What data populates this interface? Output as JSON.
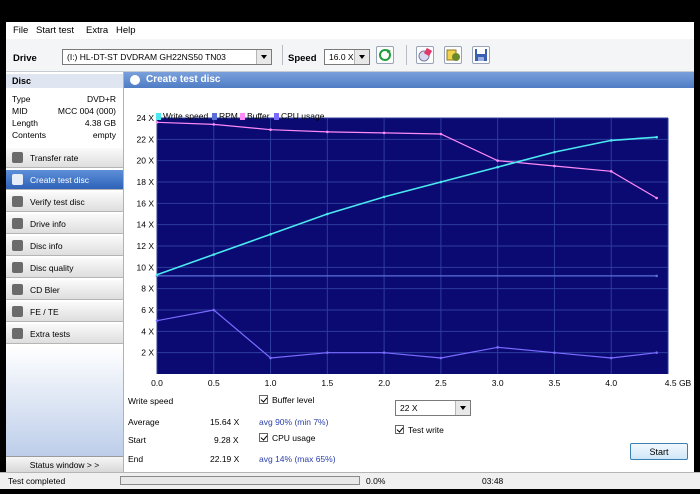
{
  "menu": [
    "File",
    "Start test",
    "Extra",
    "Help"
  ],
  "toolbar": {
    "drive_label": "Drive",
    "drive_value": "(I:)   HL-DT-ST DVDRAM GH22NS50 TN03",
    "speed_label": "Speed",
    "speed_value": "16.0 X",
    "icons": [
      "refresh-icon",
      "erase-disc-icon",
      "media-info-icon",
      "save-icon"
    ]
  },
  "disc": {
    "header": "Disc",
    "rows": [
      {
        "k": "Type",
        "v": "DVD+R"
      },
      {
        "k": "MID",
        "v": "MCC 004 (000)"
      },
      {
        "k": "Length",
        "v": "4.38 GB"
      },
      {
        "k": "Contents",
        "v": "empty"
      }
    ]
  },
  "nav": [
    {
      "label": "Transfer rate",
      "active": false
    },
    {
      "label": "Create test disc",
      "active": true
    },
    {
      "label": "Verify test disc",
      "active": false
    },
    {
      "label": "Drive info",
      "active": false
    },
    {
      "label": "Disc info",
      "active": false
    },
    {
      "label": "Disc quality",
      "active": false
    },
    {
      "label": "CD Bler",
      "active": false
    },
    {
      "label": "FE / TE",
      "active": false
    },
    {
      "label": "Extra tests",
      "active": false
    }
  ],
  "status_window_label": "Status window > >",
  "main_title": "Create test disc",
  "colors": {
    "write": "#4ce8f0",
    "rpm": "#5a6fd8",
    "buffer": "#ff8af8",
    "cpu": "#7a6aff",
    "plot_bg": "#0a0a72",
    "grid": "#2d3d9e"
  },
  "chart_data": {
    "type": "line",
    "xlabel": "",
    "ylabel": "",
    "x_unit": "GB",
    "y_unit": "X",
    "xlim": [
      0,
      4.5
    ],
    "ylim": [
      0,
      24
    ],
    "x_ticks": [
      "0.0",
      "0.5",
      "1.0",
      "1.5",
      "2.0",
      "2.5",
      "3.0",
      "3.5",
      "4.0",
      "4.5 GB"
    ],
    "y_ticks": [
      "2 X",
      "4 X",
      "6 X",
      "8 X",
      "10 X",
      "12 X",
      "14 X",
      "16 X",
      "18 X",
      "20 X",
      "22 X",
      "24 X"
    ],
    "grid": true,
    "legend_position": "top-left",
    "series": [
      {
        "name": "Write speed",
        "x": [
          0.0,
          0.5,
          1.0,
          1.5,
          2.0,
          2.5,
          3.0,
          3.5,
          4.0,
          4.4
        ],
        "y": [
          9.3,
          11.2,
          13.1,
          15.0,
          16.6,
          18.0,
          19.4,
          20.8,
          21.9,
          22.2
        ]
      },
      {
        "name": "RPM",
        "x": [
          0.0,
          4.4
        ],
        "y": [
          9.2,
          9.2
        ]
      },
      {
        "name": "Buffer",
        "x": [
          0.0,
          0.5,
          1.0,
          1.5,
          2.0,
          2.5,
          3.0,
          3.5,
          4.0,
          4.4
        ],
        "y": [
          23.6,
          23.4,
          22.9,
          22.7,
          22.6,
          22.5,
          20.0,
          19.5,
          19.0,
          16.5
        ]
      },
      {
        "name": "CPU usage",
        "x": [
          0.0,
          0.5,
          1.0,
          1.5,
          2.0,
          2.5,
          3.0,
          3.5,
          4.0,
          4.4
        ],
        "y": [
          5.0,
          6.0,
          1.5,
          2.0,
          2.0,
          1.5,
          2.5,
          2.0,
          1.5,
          2.0
        ]
      }
    ]
  },
  "stats": {
    "write_speed_label": "Write speed",
    "average_label": "Average",
    "average_value": "15.64 X",
    "start_label": "Start",
    "start_value": "9.28 X",
    "end_label": "End",
    "end_value": "22.19 X",
    "buffer_level_label": "Buffer level",
    "buffer_level_value": "avg 90% (min 7%)",
    "cpu_usage_label": "CPU usage",
    "cpu_usage_value": "avg 14% (max 65%)",
    "write_speed_select": "22 X",
    "test_write_label": "Test write",
    "start_button": "Start"
  },
  "statusbar": {
    "text": "Test completed",
    "progress_fraction": 0.0,
    "progress_text": "0.0%",
    "elapsed": "03:48"
  }
}
